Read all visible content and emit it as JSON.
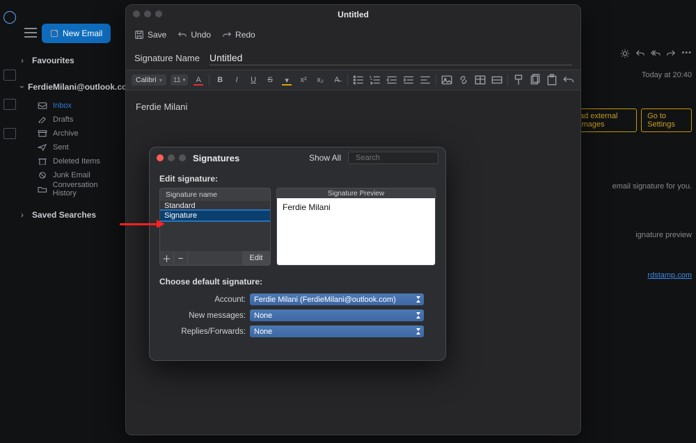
{
  "sidebar": {
    "new_email_label": "New Email",
    "favourites_label": "Favourites",
    "account_label": "FerdieMilani@outlook.co",
    "folders": [
      {
        "label": "Inbox",
        "active": true
      },
      {
        "label": "Drafts",
        "active": false
      },
      {
        "label": "Archive",
        "active": false
      },
      {
        "label": "Sent",
        "active": false
      },
      {
        "label": "Deleted Items",
        "active": false
      },
      {
        "label": "Junk Email",
        "active": false
      },
      {
        "label": "Conversation History",
        "active": false
      }
    ],
    "saved_searches_label": "Saved Searches"
  },
  "background_pane": {
    "time_label": "Today at 20:40",
    "yellow_btn1": "ad external images",
    "yellow_btn2": "Go to Settings",
    "line1": "email signature for you.",
    "line2": "ignature preview",
    "link": "rdstamp.com"
  },
  "editor_window": {
    "title": "Untitled",
    "actions": {
      "save": "Save",
      "undo": "Undo",
      "redo": "Redo"
    },
    "signature_name_label": "Signature Name",
    "signature_name_value": "Untitled",
    "toolbar": {
      "font": "Calibri",
      "size": "11"
    },
    "body_text": "Ferdie Milani"
  },
  "signatures_modal": {
    "title": "Signatures",
    "show_all_label": "Show All",
    "search_placeholder": "Search",
    "edit_signature_label": "Edit signature:",
    "list_header": "Signature name",
    "list_items": [
      {
        "name": "Standard",
        "editing": false
      },
      {
        "name": "Signature",
        "editing": true
      }
    ],
    "edit_button": "Edit",
    "preview_header": "Signature Preview",
    "preview_body": "Ferdie Milani",
    "defaults_label": "Choose default signature:",
    "defaults": {
      "account_label": "Account:",
      "account_value": "Ferdie Milani (FerdieMilani@outlook.com)",
      "new_messages_label": "New messages:",
      "new_messages_value": "None",
      "replies_label": "Replies/Forwards:",
      "replies_value": "None"
    }
  }
}
